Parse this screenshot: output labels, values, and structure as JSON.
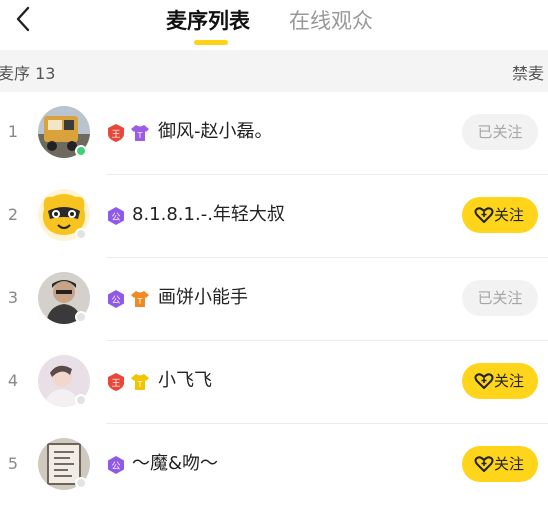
{
  "header": {
    "tabs": [
      {
        "label": "麦序列表",
        "active": true
      },
      {
        "label": "在线观众",
        "active": false
      }
    ],
    "accent_color": "#ffd21a"
  },
  "subbar": {
    "count_label": "麦序 13",
    "mute_label": "禁麦"
  },
  "list": [
    {
      "index": "1",
      "nickname": "御风-赵小磊。",
      "badges": [
        {
          "glyph": "王",
          "icon": "king-shield-icon",
          "color": "#e8473a"
        },
        {
          "glyph": "T",
          "icon": "purple-shirt-icon",
          "color": "#9b5de5"
        }
      ],
      "online": true,
      "button": {
        "label": "已关注",
        "followed": true
      }
    },
    {
      "index": "2",
      "nickname": "8.1.8.1.-.年轻大叔",
      "badges": [
        {
          "glyph": "公",
          "icon": "guild-hexagon-icon",
          "color": "#8f5ae8"
        }
      ],
      "online": false,
      "button": {
        "label": "关注",
        "followed": false
      }
    },
    {
      "index": "3",
      "nickname": "画饼小能手",
      "badges": [
        {
          "glyph": "公",
          "icon": "guild-hexagon-icon",
          "color": "#8f5ae8"
        },
        {
          "glyph": "T",
          "icon": "orange-shirt-icon",
          "color": "#f08a24"
        }
      ],
      "online": false,
      "button": {
        "label": "已关注",
        "followed": true
      }
    },
    {
      "index": "4",
      "nickname": "小飞飞",
      "badges": [
        {
          "glyph": "王",
          "icon": "king-shield-icon",
          "color": "#e8473a"
        },
        {
          "glyph": "T",
          "icon": "yellow-shirt-icon",
          "color": "#f5c400"
        }
      ],
      "online": false,
      "button": {
        "label": "关注",
        "followed": false
      }
    },
    {
      "index": "5",
      "nickname": "～魔&吻～",
      "badges": [
        {
          "glyph": "公",
          "icon": "guild-hexagon-icon",
          "color": "#8f5ae8"
        }
      ],
      "online": false,
      "button": {
        "label": "关注",
        "followed": false
      }
    }
  ]
}
